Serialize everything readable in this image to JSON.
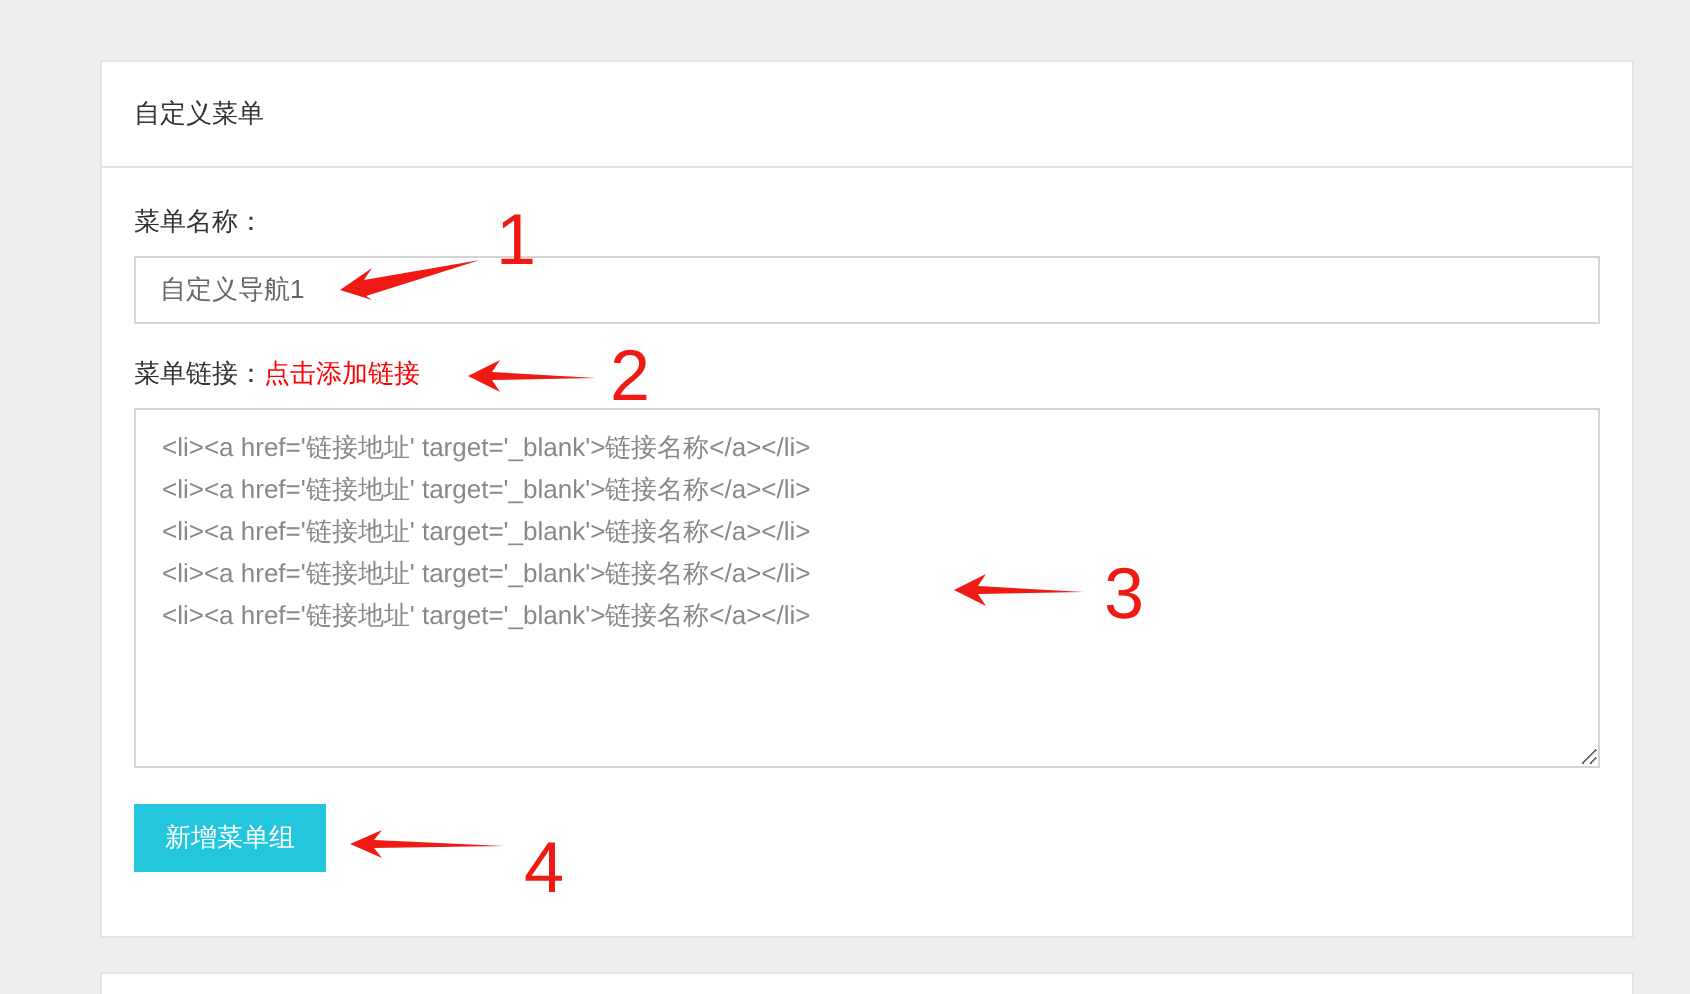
{
  "card": {
    "title": "自定义菜单"
  },
  "name_field": {
    "label": "菜单名称：",
    "value": "自定义导航1"
  },
  "link_field": {
    "label": "菜单链接：",
    "action": "点击添加链接",
    "lines": [
      "<li><a href='链接地址' target='_blank'>链接名称</a></li>",
      "<li><a href='链接地址' target='_blank'>链接名称</a></li>",
      "<li><a href='链接地址' target='_blank'>链接名称</a></li>",
      "<li><a href='链接地址' target='_blank'>链接名称</a></li>",
      "<li><a href='链接地址' target='_blank'>链接名称</a></li>"
    ]
  },
  "add_button": "新增菜单组",
  "annotations": [
    "1",
    "2",
    "3",
    "4"
  ]
}
